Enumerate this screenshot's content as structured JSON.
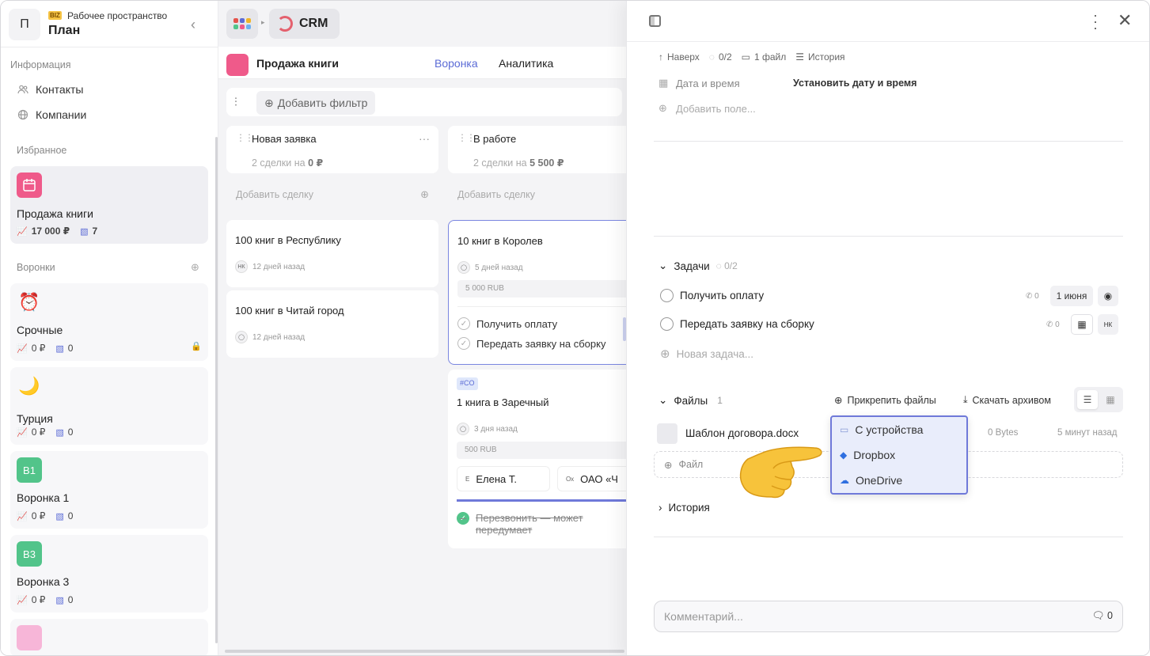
{
  "workspace": {
    "initial": "П",
    "badge": "BIZ",
    "subtitle": "Рабочее пространство",
    "name": "План"
  },
  "sidebar": {
    "info_label": "Информация",
    "contacts": "Контакты",
    "companies": "Компании",
    "favorites_label": "Избранное",
    "favorite": {
      "title": "Продажа книги",
      "amount": "17 000 ₽",
      "count": "7"
    },
    "funnels_label": "Воронки",
    "funnels": [
      {
        "title": "Срочные",
        "amount": "0 ₽",
        "count": "0",
        "icon": "alarm-icon"
      },
      {
        "title": "Турция",
        "amount": "0 ₽",
        "count": "0",
        "icon": "moon-icon"
      },
      {
        "title": "Воронка 1",
        "amount": "0 ₽",
        "count": "0",
        "badge": "В1",
        "badge_color": "#52c48a"
      },
      {
        "title": "Воронка 3",
        "amount": "0 ₽",
        "count": "0",
        "badge": "В3",
        "badge_color": "#52c48a"
      }
    ]
  },
  "topbar": {
    "crm": "CRM"
  },
  "board": {
    "title": "Продажа книги",
    "tab_funnel": "Воронка",
    "tab_analytics": "Аналитика",
    "add_filter": "Добавить фильтр",
    "add_deal": "Добавить сделку",
    "columns": [
      {
        "name": "Новая заявка",
        "summary_pre": "2 сделки на ",
        "summary_amount": "0 ₽"
      },
      {
        "name": "В работе",
        "summary_pre": "2 сделки на ",
        "summary_amount": "5 500 ₽"
      }
    ],
    "deals": {
      "d1": {
        "title": "100 книг в Республику",
        "avatar": "НК",
        "time": "12 дней назад"
      },
      "d2": {
        "title": "100 книг в Читай город",
        "time": "12 дней назад"
      },
      "d3": {
        "title": "10 книг в Королев",
        "time": "5 дней назад",
        "price": "5 000 RUB",
        "task1": "Получить оплату",
        "task2": "Передать заявку на сборку"
      },
      "d4": {
        "tag": "#CO",
        "title": "1 книга в Заречный",
        "time": "3 дня назад",
        "price": "500 RUB",
        "person_initial": "Е",
        "person": "Елена Т.",
        "org_initial": "Ох",
        "org": "ОАО «Ч",
        "done_task": "Перезвонить — может передумает"
      }
    }
  },
  "panel": {
    "up": "Наверх",
    "tasks_count": "0/2",
    "files_count": "1 файл",
    "history": "История",
    "date_label": "Дата и время",
    "date_value": "Установить дату и время",
    "add_field": "Добавить поле...",
    "tasks_title": "Задачи",
    "tasks_progress": "0/2",
    "tasks": [
      {
        "title": "Получить оплату",
        "calls": "0",
        "date": "1 июня"
      },
      {
        "title": "Передать заявку на сборку",
        "calls": "0",
        "avatar": "НК"
      }
    ],
    "new_task": "Новая задача...",
    "files_title": "Файлы",
    "files_num": "1",
    "attach": "Прикрепить файлы",
    "download": "Скачать архивом",
    "file": {
      "name": "Шаблон договора.docx",
      "size": "0 Bytes",
      "time": "5 минут назад"
    },
    "dropzone": "Файл",
    "menu": [
      "С устройства",
      "Dropbox",
      "OneDrive"
    ],
    "history_title": "История",
    "comment_placeholder": "Комментарий...",
    "comment_count": "0"
  }
}
